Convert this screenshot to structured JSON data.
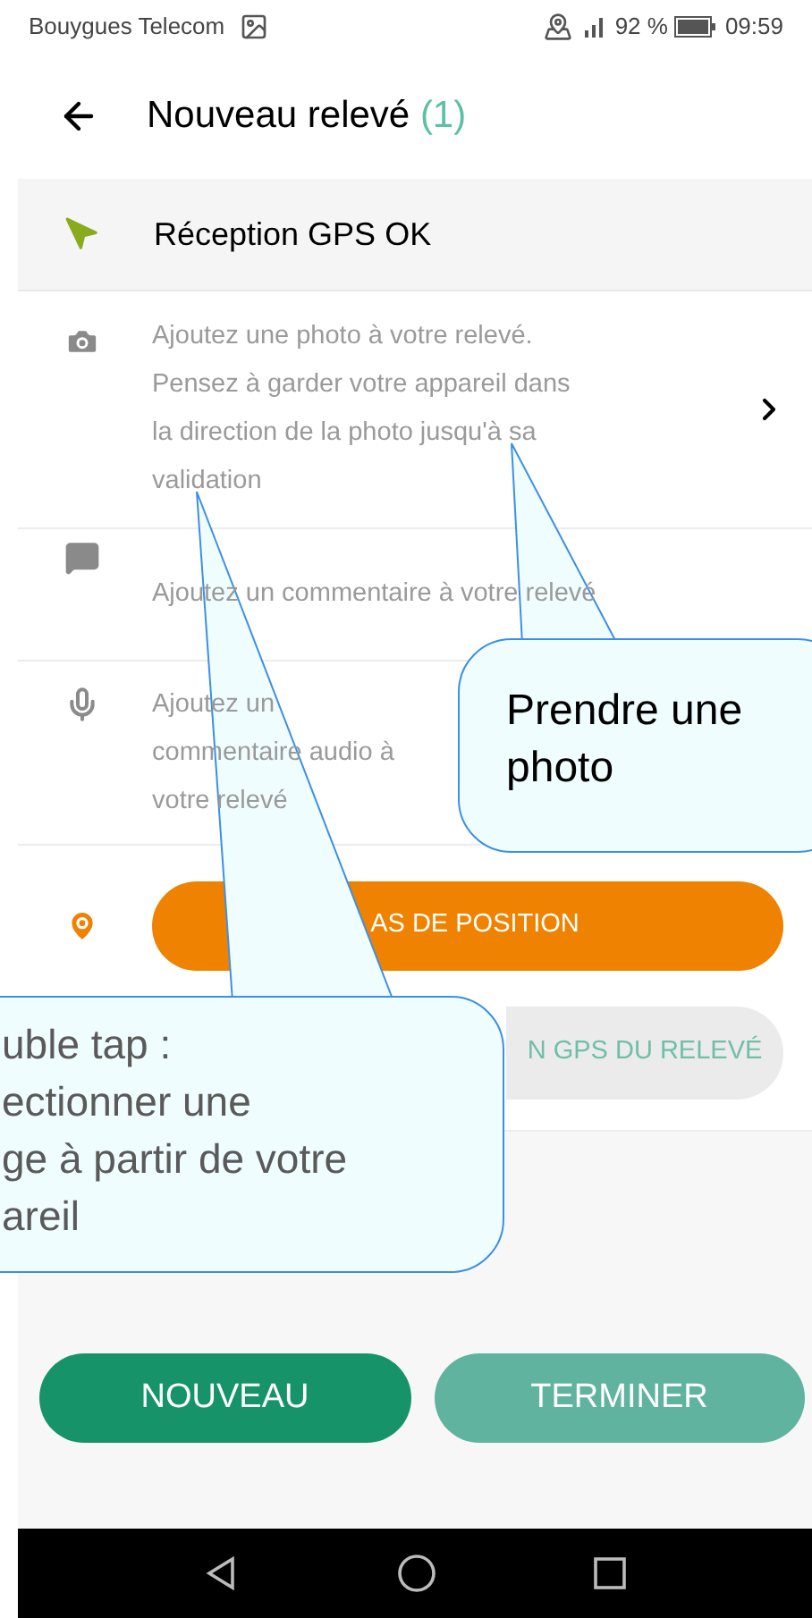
{
  "status_bar": {
    "carrier": "Bouygues Telecom",
    "battery": "92 %",
    "time": "09:59"
  },
  "header": {
    "title": "Nouveau relevé",
    "count": "(1)"
  },
  "gps": {
    "text": "Réception GPS OK"
  },
  "rows": [
    {
      "kind": "photo",
      "text": "Ajoutez une photo à votre relevé. Pensez à garder votre appareil dans la direction de la photo jusqu'à sa validation",
      "chevron": true
    },
    {
      "kind": "comment",
      "text": "Ajoutez un commentaire à votre relevé",
      "chevron": false
    },
    {
      "kind": "audio",
      "text": "Ajoutez un commentaire audio à votre relevé",
      "chevron": false
    }
  ],
  "position": {
    "buttons": [
      {
        "kind": "primary",
        "text": "AS DE POSITION"
      },
      {
        "kind": "secondary",
        "text": "N GPS DU RELEVÉ"
      }
    ]
  },
  "actions": [
    {
      "kind": "primary",
      "label": "NOUVEAU"
    },
    {
      "kind": "secondary",
      "label": "TERMINER"
    }
  ],
  "callouts": [
    {
      "kind": "photo_hint",
      "text": "Prendre une photo"
    },
    {
      "kind": "tap_hint",
      "text": "uble tap :\nectionner une\nge à partir de votre\nareil"
    }
  ]
}
